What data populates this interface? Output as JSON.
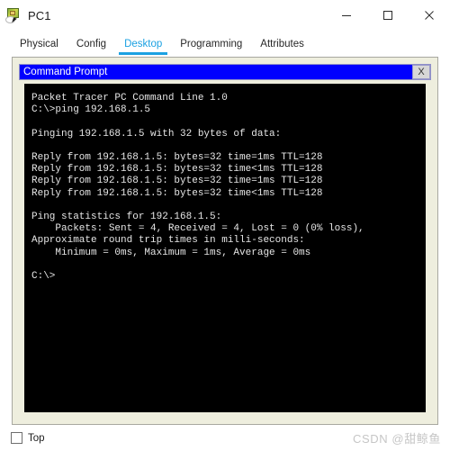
{
  "window": {
    "title": "PC1",
    "icon": "packet-tracer-pc-icon",
    "minimize_label": "–",
    "maximize_label": "□",
    "close_label": "✕"
  },
  "tabs": [
    {
      "label": "Physical",
      "active": false
    },
    {
      "label": "Config",
      "active": false
    },
    {
      "label": "Desktop",
      "active": true
    },
    {
      "label": "Programming",
      "active": false
    },
    {
      "label": "Attributes",
      "active": false
    }
  ],
  "command_prompt": {
    "title": "Command Prompt",
    "close_label": "X",
    "accent_color": "#0000ff",
    "lines": [
      "Packet Tracer PC Command Line 1.0",
      "C:\\>ping 192.168.1.5",
      "",
      "Pinging 192.168.1.5 with 32 bytes of data:",
      "",
      "Reply from 192.168.1.5: bytes=32 time=1ms TTL=128",
      "Reply from 192.168.1.5: bytes=32 time<1ms TTL=128",
      "Reply from 192.168.1.5: bytes=32 time=1ms TTL=128",
      "Reply from 192.168.1.5: bytes=32 time<1ms TTL=128",
      "",
      "Ping statistics for 192.168.1.5:",
      "    Packets: Sent = 4, Received = 4, Lost = 0 (0% loss),",
      "Approximate round trip times in milli-seconds:",
      "    Minimum = 0ms, Maximum = 1ms, Average = 0ms",
      "",
      "C:\\>"
    ]
  },
  "footer": {
    "top_checkbox_label": "Top",
    "top_checkbox_checked": false,
    "watermark": "CSDN @甜鲸鱼"
  }
}
